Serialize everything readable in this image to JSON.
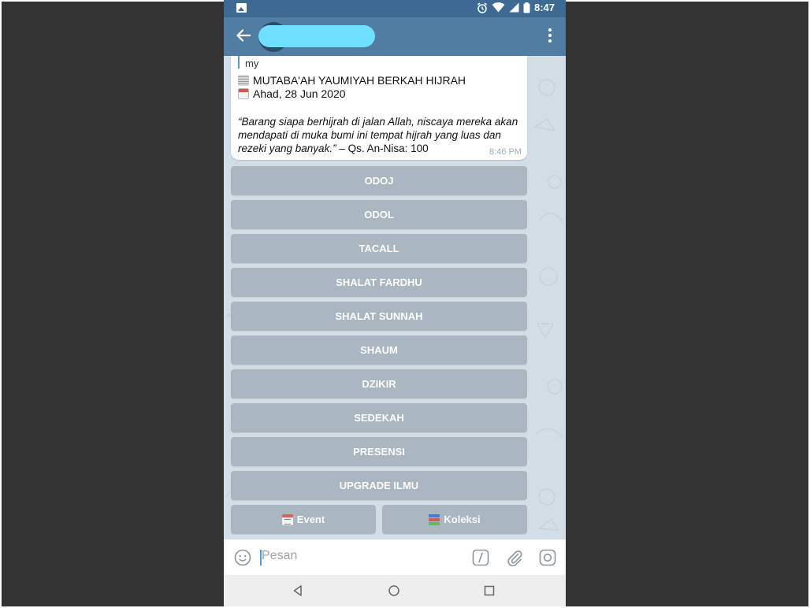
{
  "status_bar": {
    "time": "8:47",
    "icons": [
      "image-icon",
      "alarm-icon",
      "wifi-icon",
      "signal-icon",
      "battery-icon"
    ]
  },
  "toolbar": {
    "back_icon": "arrow-left-icon",
    "chat_title": "",
    "menu_icon": "more-vertical-icon"
  },
  "message": {
    "reply_preview": "my",
    "title": "MUTABA'AH YAUMIYAH BERKAH HIJRAH",
    "date": "Ahad, 28 Jun 2020",
    "quote": "“Barang siapa berhijrah di jalan Allah, niscaya mereka akan mendapati di muka bumi ini tempat hijrah yang luas dan rezeki yang banyak.”",
    "reference": " – Qs. An-Nisa: 100",
    "time": "8:46 PM"
  },
  "keyboard": {
    "buttons": [
      "ODOJ",
      "ODOL",
      "TACALL",
      "SHALAT FARDHU",
      "SHALAT SUNNAH",
      "SHAUM",
      "DZIKIR",
      "SEDEKAH",
      "PRESENSI",
      "UPGRADE ILMU"
    ],
    "event_label": "Event",
    "koleksi_label": "Koleksi"
  },
  "input": {
    "placeholder": "Pesan",
    "value": ""
  },
  "colors": {
    "status_bar": "#3d6a92",
    "toolbar": "#527da3",
    "chat_bg": "#d3dde6",
    "keyboard_button": "#a9b5bf",
    "accent": "#4f9bd6"
  }
}
